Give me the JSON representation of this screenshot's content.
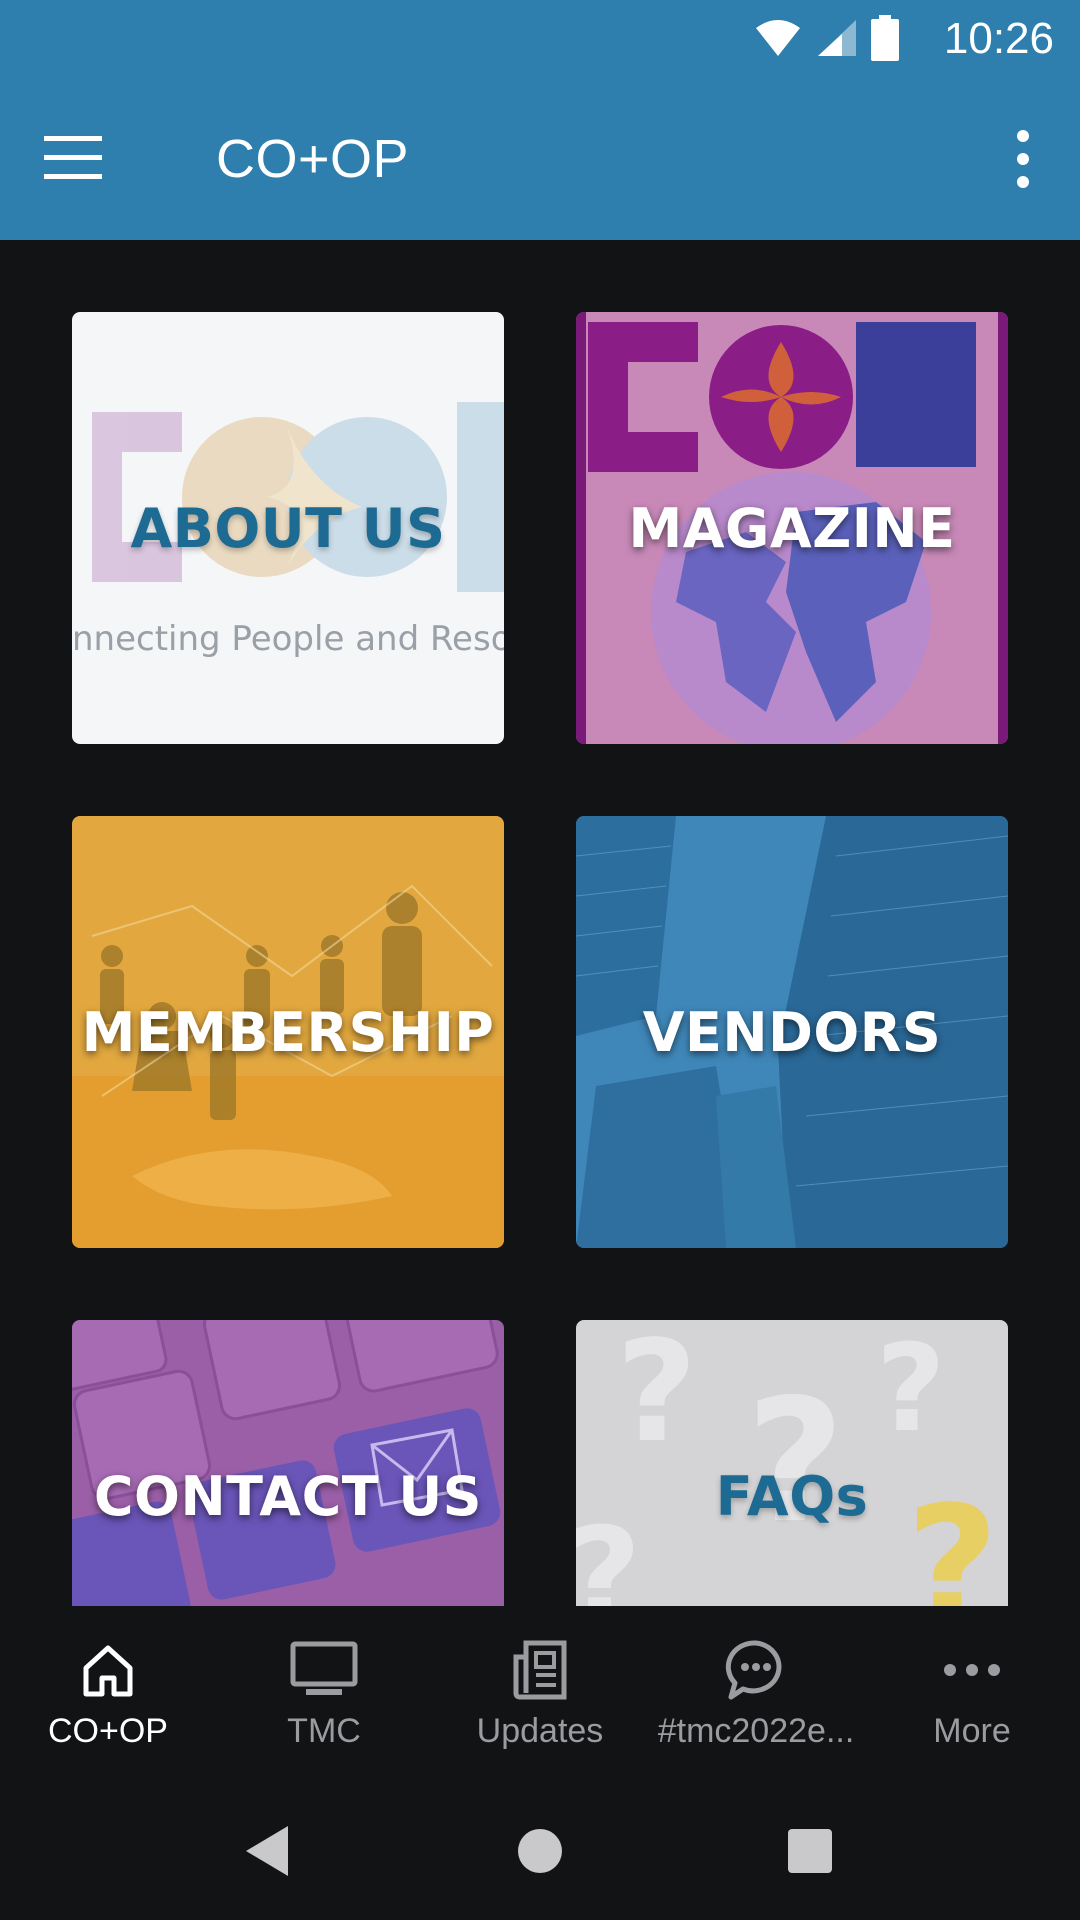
{
  "status_bar": {
    "time": "10:26"
  },
  "app_bar": {
    "title": "CO+OP"
  },
  "tiles": [
    {
      "label": "ABOUT US",
      "sub": "nnecting People and Resourc"
    },
    {
      "label": "MAGAZINE"
    },
    {
      "label": "MEMBERSHIP"
    },
    {
      "label": "VENDORS"
    },
    {
      "label": "CONTACT US"
    },
    {
      "label": "FAQs"
    }
  ],
  "bottom_nav": [
    {
      "label": "CO+OP",
      "icon": "home-icon",
      "active": true
    },
    {
      "label": "TMC",
      "icon": "monitor-icon"
    },
    {
      "label": "Updates",
      "icon": "newspaper-icon"
    },
    {
      "label": "#tmc2022e...",
      "icon": "chat-bubble-icon"
    },
    {
      "label": "More",
      "icon": "more-dots-icon"
    }
  ],
  "colors": {
    "primary": "#2e7fae",
    "background": "#121315",
    "about_label": "#1d6a93",
    "magazine_tint": "#c889b8",
    "membership_tint": "#e2a83f",
    "vendors_tint": "#2c6f9e",
    "contact_tint": "#9b5fa8",
    "faq_tint": "#d4d4d6"
  }
}
